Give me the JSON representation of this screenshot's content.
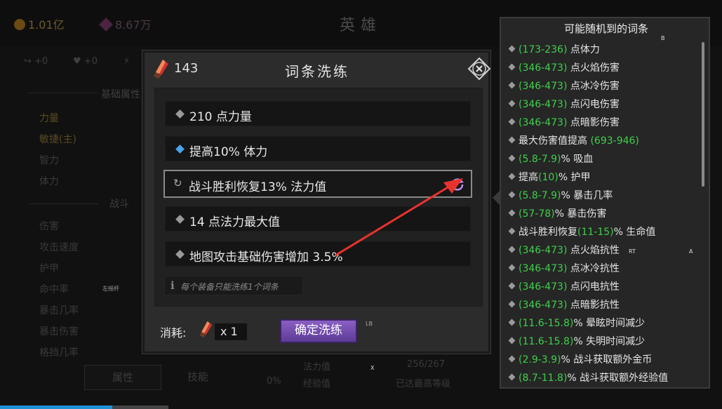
{
  "background": {
    "gold": "1.01亿",
    "gems": "8.67万",
    "screen_title": "英雄",
    "stat_a": "+0",
    "stat_b": "+0",
    "section_basic": "基础属性",
    "section_battle": "战斗",
    "basic_items": [
      "力量",
      "敏捷(主)",
      "智力",
      "体力"
    ],
    "battle_items": [
      "伤害",
      "攻击速度",
      "护甲",
      "命中率",
      "暴击几率",
      "暴击伤害",
      "格挡几率"
    ],
    "tabs": [
      "属性",
      "技能"
    ],
    "footer_left": "0%",
    "footer_mid_1": "法力值",
    "footer_mid_2": "经验值",
    "footer_right_1": "256/267",
    "footer_right_2": "已达最高等级",
    "joystick_tag": "左摇杆"
  },
  "dialog": {
    "currency_count": "143",
    "title": "词条洗练",
    "affixes": [
      {
        "text": "210 点力量",
        "marker": "gray"
      },
      {
        "text": "提高10% 体力",
        "marker": "blue"
      },
      {
        "text": "战斗胜利恢复13% 法力值",
        "marker": "refresh",
        "selected": true
      },
      {
        "text": "14 点法力最大值",
        "marker": "gray"
      },
      {
        "text": "地图攻击基础伤害增加 3.5%",
        "marker": "gray"
      }
    ],
    "hint": "每个装备只能洗练1个词条",
    "cost_label": "消耗:",
    "cost_qty": "x 1",
    "confirm_label": "确定洗练",
    "lb_tag": "LB"
  },
  "pool": {
    "title": "可能随机到的词条",
    "b_tag": "B",
    "items": [
      {
        "pre": "",
        "range": "(173-236)",
        "post": " 点体力"
      },
      {
        "pre": "",
        "range": "(346-473)",
        "post": " 点火焰伤害"
      },
      {
        "pre": "",
        "range": "(346-473)",
        "post": " 点冰冷伤害"
      },
      {
        "pre": "",
        "range": "(346-473)",
        "post": " 点闪电伤害"
      },
      {
        "pre": "",
        "range": "(346-473)",
        "post": " 点暗影伤害"
      },
      {
        "pre": "最大伤害值提高 ",
        "range": "(693-946)",
        "post": ""
      },
      {
        "pre": "",
        "range": "(5.8-7.9)",
        "post": "% 吸血"
      },
      {
        "pre": "提高",
        "range": "(10)",
        "post": "% 护甲"
      },
      {
        "pre": "",
        "range": "(5.8-7.9)",
        "post": "% 暴击几率"
      },
      {
        "pre": "",
        "range": "(57-78)",
        "post": "% 暴击伤害"
      },
      {
        "pre": "战斗胜利恢复",
        "range": "(11-15)",
        "post": "% 生命值"
      },
      {
        "pre": "",
        "range": "(346-473)",
        "post": " 点火焰抗性"
      },
      {
        "pre": "",
        "range": "(346-473)",
        "post": " 点冰冷抗性"
      },
      {
        "pre": "",
        "range": "(346-473)",
        "post": " 点闪电抗性"
      },
      {
        "pre": "",
        "range": "(346-473)",
        "post": " 点暗影抗性"
      },
      {
        "pre": "",
        "range": "(11.6-15.8)",
        "post": "% 晕眩时间减少"
      },
      {
        "pre": "",
        "range": "(11.6-15.8)",
        "post": "% 失明时间减少"
      },
      {
        "pre": "",
        "range": "(2.9-3.9)",
        "post": "% 战斗获取额外金币"
      },
      {
        "pre": "",
        "range": "(8.7-11.8)",
        "post": "% 战斗获取额外经验值"
      }
    ]
  },
  "controller_tags": {
    "rt": "RT",
    "a": "A",
    "x": "X"
  },
  "colors": {
    "range_green": "#3ed04a",
    "confirm_purple": "#7a52b3",
    "arrow_red": "#e8322e"
  }
}
